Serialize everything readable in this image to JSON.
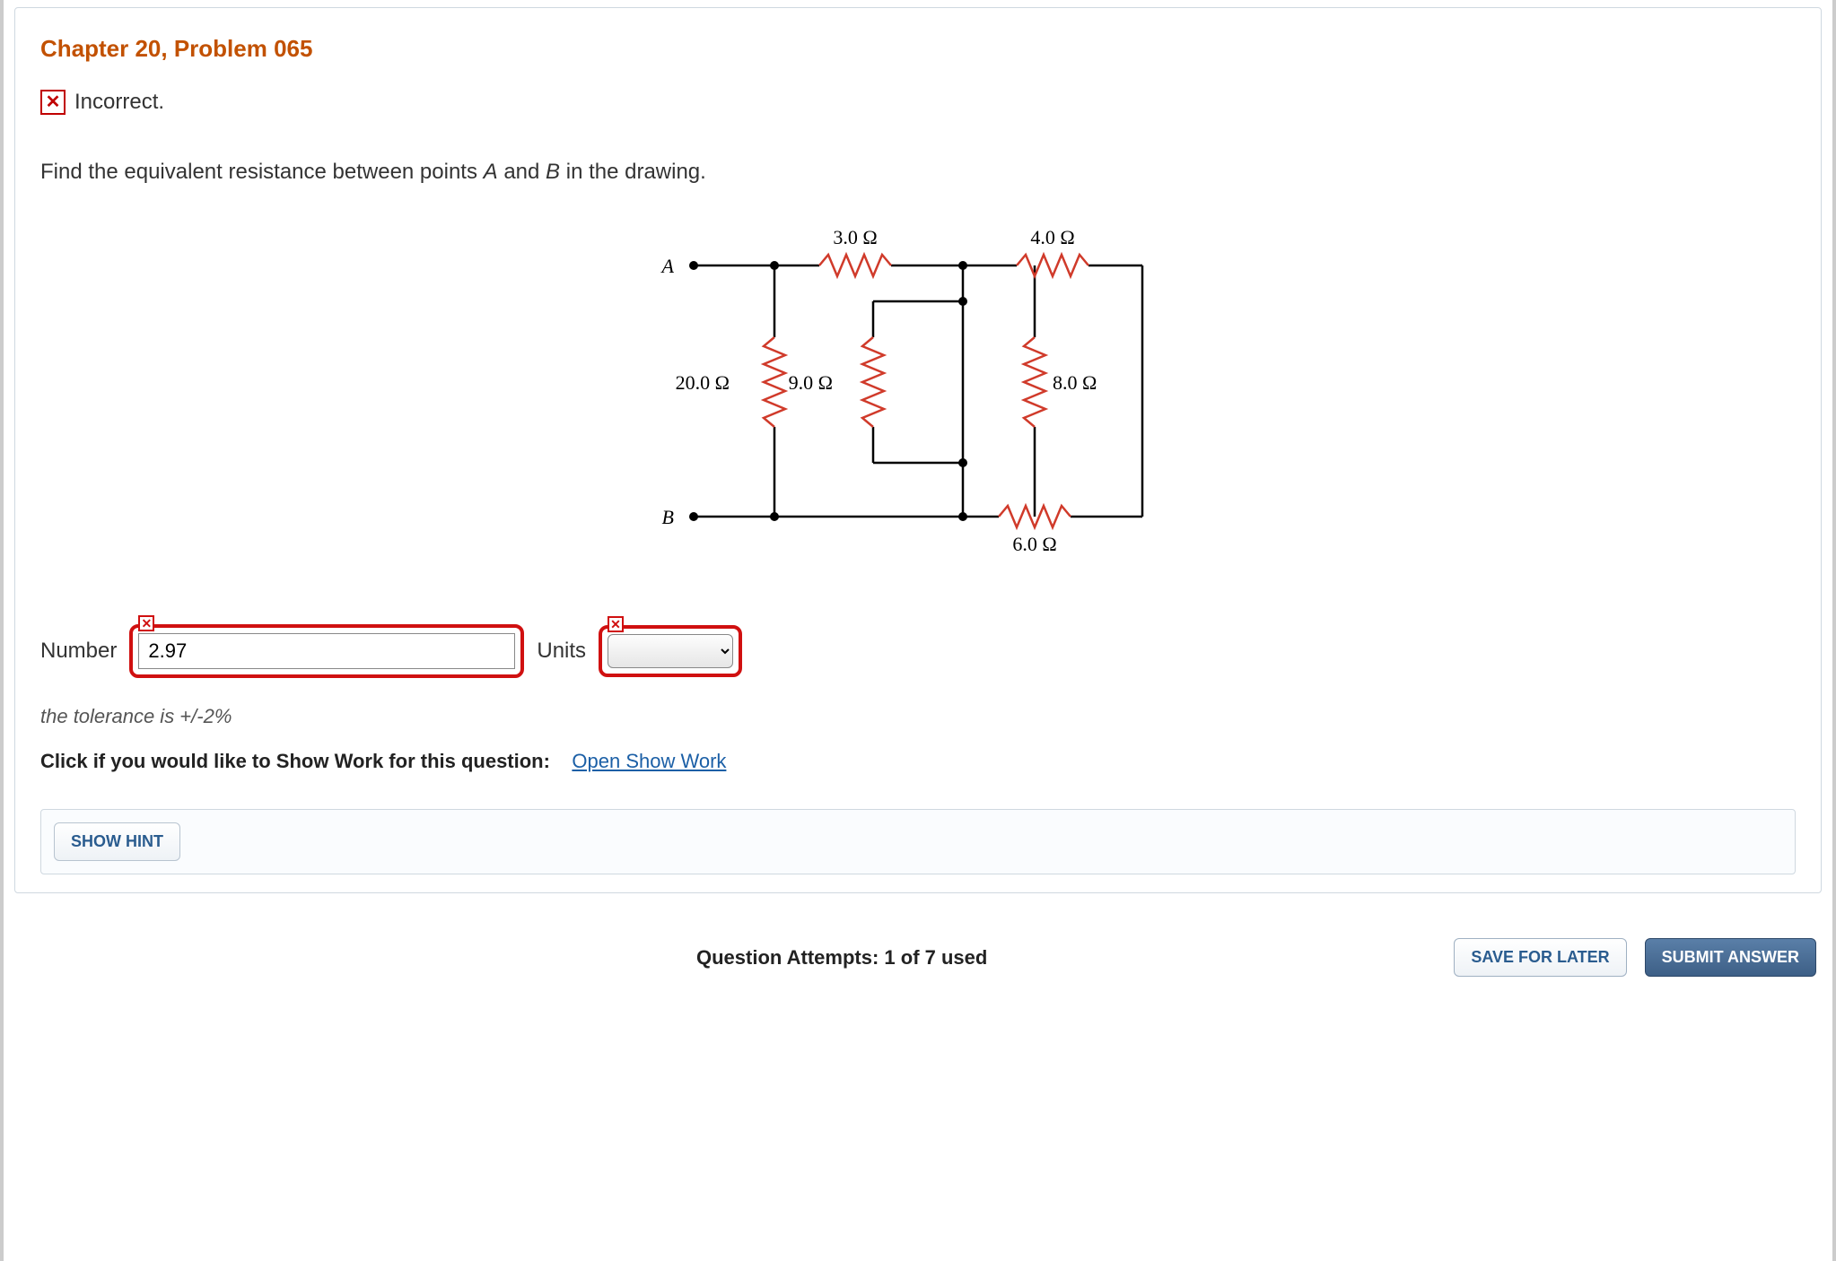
{
  "title": "Chapter 20, Problem 065",
  "feedback": {
    "icon": "x",
    "text": "Incorrect."
  },
  "prompt_prefix": "Find the equivalent resistance between points ",
  "prompt_mid": " and ",
  "prompt_suffix": " in the drawing.",
  "point_a": "A",
  "point_b": "B",
  "circuit": {
    "node_a": "A",
    "node_b": "B",
    "r_top_left": "3.0 Ω",
    "r_top_right": "4.0 Ω",
    "r_left_vert": "20.0 Ω",
    "r_mid_vert": "9.0 Ω",
    "r_right_vert": "8.0 Ω",
    "r_bottom_right": "6.0 Ω"
  },
  "answer": {
    "number_label": "Number",
    "number_value": "2.97",
    "units_label": "Units",
    "units_value": ""
  },
  "tolerance": "the tolerance is +/-2%",
  "show_work_label": "Click if you would like to Show Work for this question:",
  "show_work_link": "Open Show Work",
  "show_hint": "SHOW HINT",
  "attempts_label": "Question Attempts: 1 of 7 used",
  "save_button": "SAVE FOR LATER",
  "submit_button": "SUBMIT ANSWER"
}
